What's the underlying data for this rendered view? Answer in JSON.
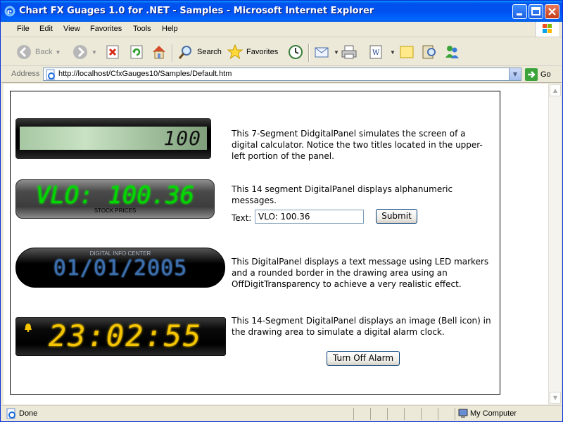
{
  "window": {
    "title": "Chart FX Guages 1.0 for .NET - Samples - Microsoft Internet Explorer"
  },
  "menu": [
    "File",
    "Edit",
    "View",
    "Favorites",
    "Tools",
    "Help"
  ],
  "toolbar": {
    "back": "Back",
    "search": "Search",
    "favorites": "Favorites"
  },
  "address": {
    "label": "Address",
    "url": "http://localhost/CfxGauges10/Samples/Default.htm",
    "go": "Go"
  },
  "panels": {
    "calculator": {
      "digits": "100",
      "description": "This 7-Segment DidgitalPanel simulates the screen of a digital calculator. Notice the two titles located in the upper-left portion of the panel."
    },
    "stock": {
      "message": "VLO: 100.36",
      "caption": "STOCK PRICES",
      "description": "This 14 segment DigitalPanel displays alphanumeric messages.",
      "text_label": "Text:",
      "text_value": "VLO: 100.36",
      "submit_label": "Submit"
    },
    "info": {
      "caption": "DIGITAL INFO CENTER",
      "date": "01/01/2005",
      "description": "This DigitalPanel displays a text message using LED markers and a rounded border in the drawing area using an OffDigitTransparency to achieve a very realistic effect."
    },
    "alarm": {
      "time": "23:02:55",
      "description": "This 14-Segment DigitalPanel displays an image (Bell icon) in the drawing area to simulate a digital alarm clock.",
      "button_label": "Turn Off Alarm"
    }
  },
  "status": {
    "text": "Done",
    "zone": "My Computer"
  },
  "colors": {
    "lcd_green": "#00d800",
    "led_blue": "#4a90d9",
    "alarm_amber": "#f5c400"
  }
}
